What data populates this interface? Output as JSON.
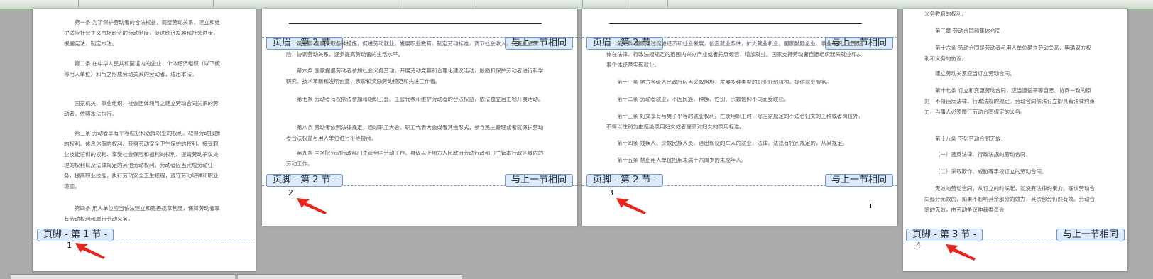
{
  "labels": {
    "footer_1": "页脚 - 第 1 节 -",
    "header_2": "页眉 - 第 2 节 -",
    "footer_2": "页脚 - 第 2 节 -",
    "header_3": "页眉 - 第 2 节 -",
    "footer_3": "页脚 - 第 2 节 -",
    "footer_4": "页脚 - 第 3 节 -",
    "same_as_prev": "与上一节相同"
  },
  "page_numbers": [
    "1",
    "2",
    "3",
    "4"
  ],
  "colors": {
    "accent": "#6b9ad6",
    "arrow": "#e8261f",
    "tag_bg": "#dde9f8"
  },
  "pages": [
    {
      "paragraphs": [
        "第一条 为了保护劳动者的合法权益，调整劳动关系，建立和维护适应社会主义市场经济的劳动制度，促进经济发展和社会进步，根据宪法，制定本法。",
        "第二条 在中华人民共和国境内的企业、个体经济组织（以下统称用人单位）和与之形成劳动关系的劳动者，适用本法。",
        "国家机关、事业组织、社会团体和与之建立劳动合同关系的劳动者，依照本法执行。",
        "第三条 劳动者享有平等就业和选择职业的权利、取得劳动报酬的权利、休息休假的权利、获得劳动安全卫生保护的权利、接受职业技能培训的权利、享受社会保险和福利的权利、提请劳动争议处理的权利以及法律规定的其他劳动权利。劳动者应当完成劳动任务，提高职业技能，执行劳动安全卫生规程，遵守劳动纪律和职业道德。",
        "第四条 用人单位应当依法建立和完善规章制度，保障劳动者享有劳动权利和履行劳动义务。"
      ]
    },
    {
      "paragraphs": [
        "第五条 国家采取各种措施，促进劳动就业，发展职业教育，制定劳动标准，调节社会收入，完善社会保险，协调劳动关系，逐步提高劳动者的生活水平。",
        "第六条 国家提倡劳动者参加社会义务劳动，开展劳动竞赛和合理化建议活动，鼓励和保护劳动者进行科学研究、技术革新和发明创造，表彰和奖励劳动模范和先进工作者。",
        "第七条 劳动者有权依法参加和组织工会。工会代表和维护劳动者的合法权益，依法独立自主地开展活动。",
        "第八条 劳动者依照法律规定，通过职工大会、职工代表大会或者其他形式，参与民主管理或者就保护劳动者合法权益与用人单位进行平等协商。",
        "第九条 国务院劳动行政部门主管全国劳动工作。县级以上地方人民政府劳动行政部门主管本行政区域内的劳动工作。"
      ]
    },
    {
      "paragraphs": [
        "第十条 国家通过促进经济和社会发展，创造就业条件，扩大就业机会。国家鼓励企业、事业组织、社会团体在法律、行政法规规定的范围内兴办产业或者拓展经营，增加就业。国家支持劳动者自愿组织起来就业和从事个体经营实现就业。",
        "第十一条 地方各级人民政府应当采取措施，发展多种类型的职业介绍机构，提供就业服务。",
        "第十二条 劳动者就业，不因民族、种族、性别、宗教信仰不同而受歧视。",
        "第十三条 妇女享有与男子平等的就业权利。在录用职工时，除国家规定的不适合妇女的工种或者岗位外，不得以性别为由拒绝录用妇女或者提高对妇女的录用标准。",
        "第十四条 残疾人、少数民族人员、退出现役的军人的就业，法律、法规有特别规定的，从其规定。",
        "第十五条 禁止用人单位招用未满十六周岁的未成年人。"
      ]
    },
    {
      "paragraphs": [
        "义务教育的权利。",
        "第三章 劳动合同和集体合同",
        "第十六条 劳动合同是劳动者与用人单位确立劳动关系、明确双方权利和义务的协议。",
        "建立劳动关系应当订立劳动合同。",
        "第十七条 订立和变更劳动合同，应当遵循平等自愿、协商一致的原则，不得违反法律、行政法规的规定。劳动合同依法订立即具有法律约束力，当事人必须履行劳动合同规定的义务。",
        "第十八条 下列劳动合同无效：",
        "（一）违反法律、行政法规的劳动合同；",
        "（二）采取欺诈、威胁等手段订立的劳动合同。",
        "无效的劳动合同，从订立的时候起，就没有法律约束力。确认劳动合同部分无效的，如果不影响其余部分的效力，其余部分仍然有效。劳动合同的无效，由劳动争议仲裁委员会"
      ]
    }
  ]
}
